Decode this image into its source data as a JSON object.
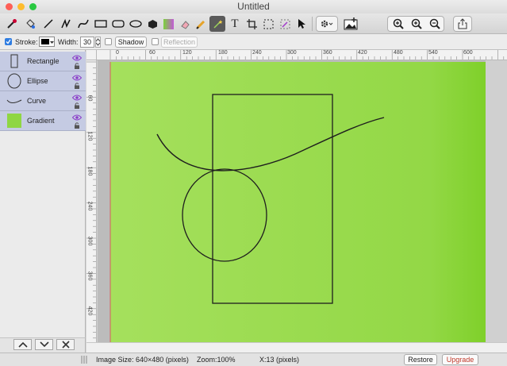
{
  "window": {
    "title": "Untitled"
  },
  "toolbar": {
    "tools": [
      "eyedropper-icon",
      "paint-bucket-icon",
      "line-icon",
      "polyline-icon",
      "bezier-curve-icon",
      "rectangle-icon",
      "rounded-rectangle-icon",
      "ellipse-icon",
      "polygon-icon",
      "gradient-icon",
      "eraser-icon",
      "pencil-icon",
      "magic-wand-icon",
      "text-icon",
      "crop-icon",
      "selection-icon",
      "magic-select-icon",
      "pointer-icon",
      "gear-icon",
      "image-insert-icon",
      "zoom-actual-icon",
      "zoom-in-icon",
      "zoom-out-icon",
      "share-icon"
    ]
  },
  "options": {
    "stroke_label": "Stroke:",
    "stroke_checked": true,
    "stroke_color": "#000000",
    "width_label": "Width:",
    "width_value": "30",
    "shadow_label": "Shadow",
    "shadow_checked": false,
    "reflection_label": "Reflection",
    "reflection_checked": false
  },
  "layers": [
    {
      "name": "Rectangle",
      "thumb": "rectangle-thumb"
    },
    {
      "name": "Ellipse",
      "thumb": "ellipse-thumb"
    },
    {
      "name": "Curve",
      "thumb": "curve-thumb"
    },
    {
      "name": "Gradient",
      "thumb": "gradient-thumb"
    }
  ],
  "rulers": {
    "horizontal": [
      "0",
      "60",
      "120",
      "180",
      "240",
      "300",
      "360",
      "420",
      "480",
      "540",
      "600"
    ],
    "vertical": [
      "60",
      "120",
      "180",
      "240",
      "300",
      "360",
      "420"
    ]
  },
  "canvas": {
    "gradient_start": "#a5e05d",
    "gradient_end": "#7fd02a",
    "stroke_color": "#1e1e1e"
  },
  "status": {
    "image_size": "Image Size: 640×480 (pixels)",
    "zoom": "Zoom:100%",
    "cursor": "X:13 (pixels)",
    "restore_label": "Restore",
    "upgrade_label": "Upgrade"
  },
  "colors": {
    "accent": "#2f7de1",
    "upgrade_text": "#c0392b",
    "layer_bg": "#c5cbe3",
    "eye_color": "#8b3fc9"
  }
}
